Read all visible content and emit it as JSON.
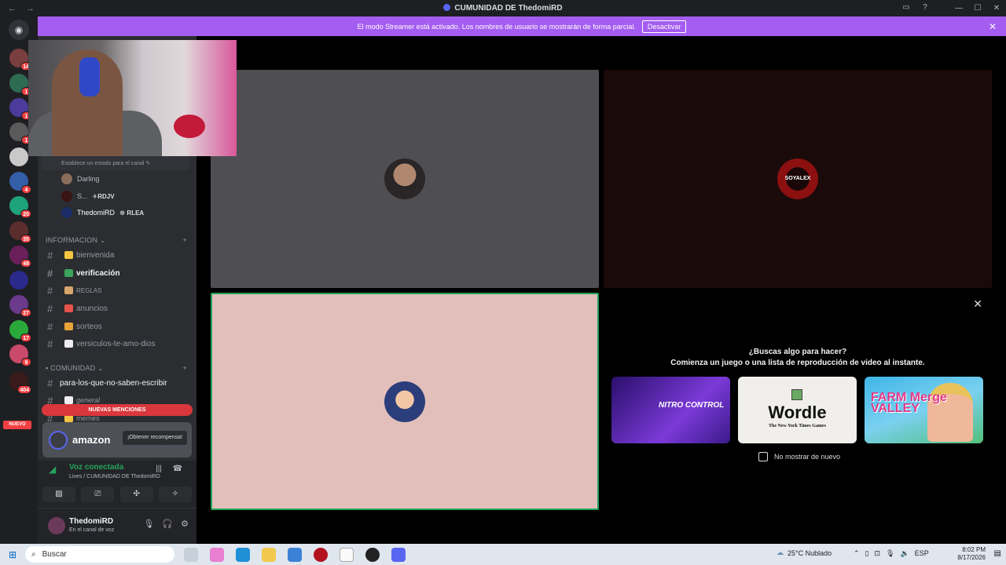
{
  "window": {
    "title": "CUMUNIDAD DE ThedomiRD",
    "controls": [
      "—",
      "☐",
      "✕"
    ]
  },
  "streamer_banner": {
    "text": "El modo Streamer está activado. Los nombres de usuario se mostrarán de forma parcial.",
    "button": "Desactivar"
  },
  "guilds": {
    "badges": [
      "14",
      "1",
      "1",
      "1",
      "4",
      "20",
      "35",
      "48",
      "27",
      "17",
      "9",
      "404"
    ],
    "nuevo": "NUEVO"
  },
  "sidebar": {
    "status_hint": "Establece un estado para el canal ✎",
    "voice_users": [
      {
        "name": "Darling",
        "tag": ""
      },
      {
        "name": "S...",
        "tag": "✈RDJV"
      },
      {
        "name": "ThedomiRD",
        "tag": "☸ RLEA"
      }
    ],
    "categories": [
      {
        "label": "INFORMACION",
        "channels": [
          {
            "name": "bienvenida",
            "emoji_color": "#f5c542"
          },
          {
            "name": "verificación",
            "emoji_color": "#3ba55c"
          },
          {
            "name": "REGLAS",
            "emoji_color": "#d6a66b"
          },
          {
            "name": "anuncios",
            "emoji_color": "#e5534b"
          },
          {
            "name": "sorteos",
            "emoji_color": "#e8a33a"
          },
          {
            "name": "versiculos-te-amo-dios",
            "emoji_color": "#eeeeee"
          }
        ]
      },
      {
        "label": "COMUNIDAD",
        "channels": [
          {
            "name": "para-los-que-no-saben-escribir",
            "emoji_color": ""
          },
          {
            "name": "general",
            "emoji_color": "#eeeeee"
          },
          {
            "name": "memes",
            "emoji_color": "#f5c542"
          }
        ]
      }
    ],
    "mentions_bar": "NUEVAS MENCIONES",
    "promo": {
      "brand": "amazon",
      "cta": "¡Obtener recompensa!"
    },
    "voice": {
      "status": "Voz conectada",
      "channel": "Lives / CUMUNIDAD DE ThedomiRD"
    },
    "user": {
      "name": "ThedomiRD",
      "status": "En el canal de voz"
    }
  },
  "stage": {
    "tile2_avatar_text": "SOYALEX",
    "activity": {
      "heading": "¿Buscas algo para hacer?",
      "subheading": "Comienza un juego o una lista de reproducción de video al instante.",
      "cards": [
        {
          "name": "NITRO CONTROL"
        },
        {
          "name": "Wordle",
          "sub": "The New York Times Games"
        },
        {
          "name": "FARM Merge VALLEY"
        }
      ],
      "checkbox_label": "No mostrar de nuevo"
    }
  },
  "taskbar": {
    "search_placeholder": "Buscar",
    "weather": "25°C Nublado",
    "lang": "ESP",
    "time": "8:02 PM",
    "date": "8/17/2026"
  },
  "colors": {
    "streamer_purple": "#a45df0",
    "active_speaker_green": "#23a55a",
    "mention_red": "#da373c"
  }
}
